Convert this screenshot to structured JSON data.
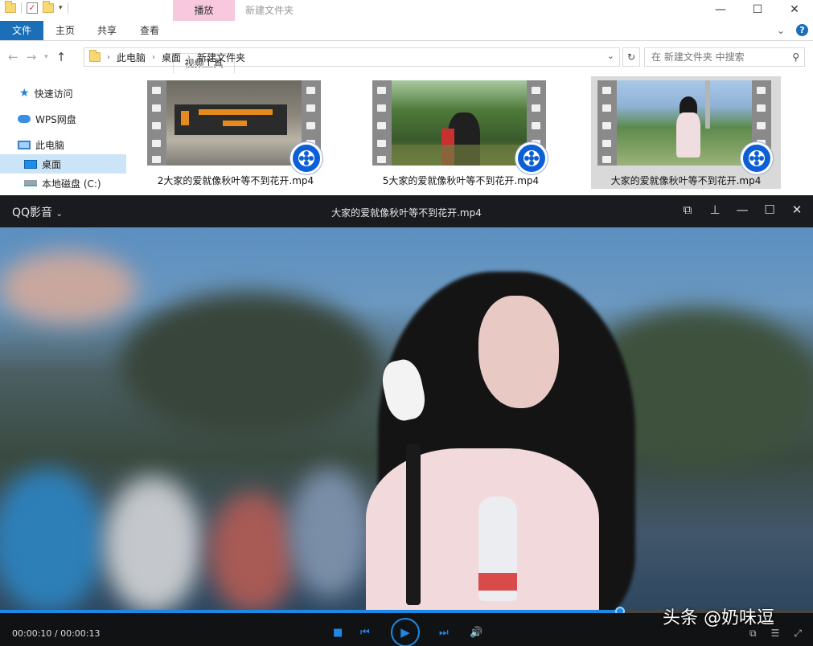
{
  "explorer": {
    "window_title": "新建文件夹",
    "context_tab": "播放",
    "ribbon_tabs": [
      "文件",
      "主页",
      "共享",
      "查看",
      "视频工具"
    ],
    "window_buttons": [
      "—",
      "☐",
      "✕"
    ],
    "address": {
      "parts": [
        "此电脑",
        "桌面",
        "新建文件夹"
      ],
      "search_placeholder": "在 新建文件夹 中搜索"
    },
    "nav_pane": [
      "快速访问",
      "WPS网盘",
      "此电脑",
      "桌面",
      "本地磁盘 (C:)"
    ],
    "files": [
      {
        "name": "2大家的爱就像秋叶等不到花开.mp4",
        "selected": false
      },
      {
        "name": "5大家的爱就像秋叶等不到花开.mp4",
        "selected": false
      },
      {
        "name": "大家的爱就像秋叶等不到花开.mp4",
        "selected": true
      }
    ]
  },
  "player": {
    "brand": "QQ影音",
    "title": "大家的爱就像秋叶等不到花开.mp4",
    "time": "00:00:10 / 00:00:13",
    "progress_fraction": 0.763
  },
  "watermark": "头条 @奶味逗",
  "colors": {
    "accent": "#1e88e5",
    "ribbon_file": "#1a6fb8",
    "context_tab": "#f7c8de"
  }
}
